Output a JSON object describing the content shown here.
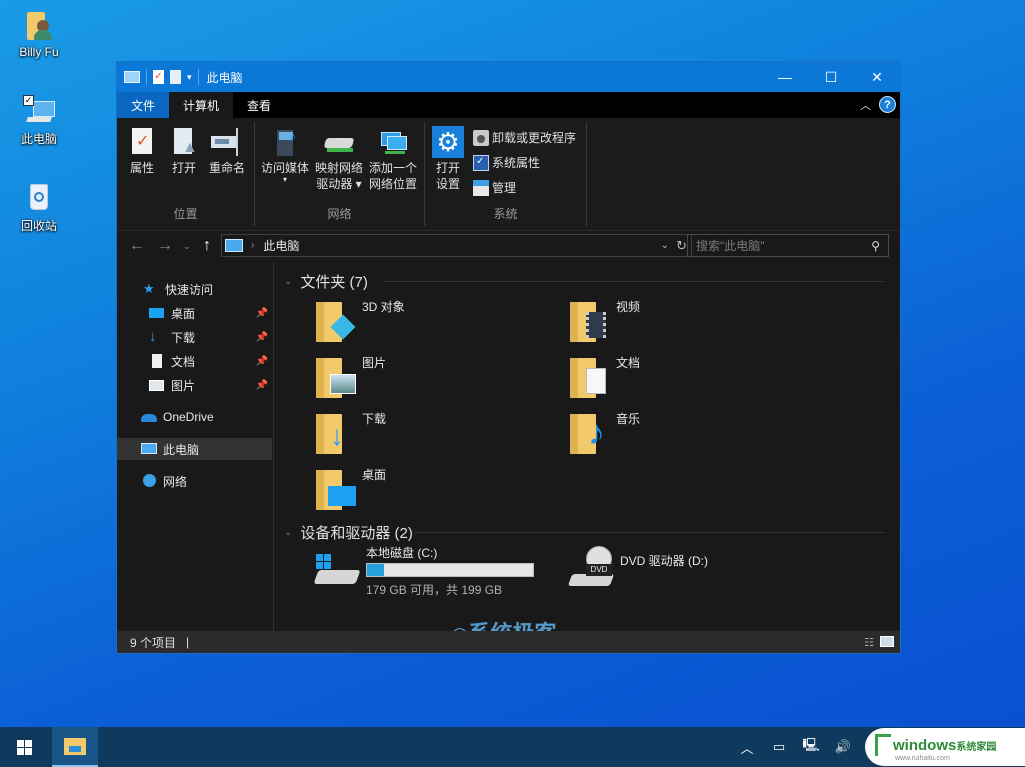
{
  "desktop": {
    "icons": [
      {
        "label": "Billy Fu",
        "icon": "user-folder-icon"
      },
      {
        "label": "此电脑",
        "icon": "this-pc-icon"
      },
      {
        "label": "回收站",
        "icon": "recycle-bin-icon"
      }
    ]
  },
  "window": {
    "title": "此电脑",
    "controls": {
      "minimize": "—",
      "maximize": "☐",
      "close": "✕"
    },
    "ribbon_tabs": [
      {
        "label": "文件"
      },
      {
        "label": "计算机"
      },
      {
        "label": "查看"
      }
    ],
    "ribbon": {
      "groups": [
        {
          "name": "位置",
          "buttons": [
            {
              "label": "属性",
              "icon": "properties-icon"
            },
            {
              "label": "打开",
              "icon": "open-icon"
            },
            {
              "label": "重命名",
              "icon": "rename-icon"
            }
          ]
        },
        {
          "name": "网络",
          "buttons": [
            {
              "label": "访问媒体",
              "icon": "media-icon",
              "dropdown": "▾"
            },
            {
              "label_line1": "映射网络",
              "label_line2": "驱动器 ▾",
              "icon": "map-drive-icon"
            },
            {
              "label_line1": "添加一个",
              "label_line2": "网络位置",
              "icon": "network-location-icon"
            }
          ]
        },
        {
          "name": "系统",
          "buttons": [
            {
              "label_line1": "打开",
              "label_line2": "设置",
              "icon": "settings-icon"
            }
          ],
          "small_buttons": [
            {
              "label": "卸载或更改程序",
              "icon": "uninstall-icon"
            },
            {
              "label": "系统属性",
              "icon": "system-properties-icon"
            },
            {
              "label": "管理",
              "icon": "manage-icon"
            }
          ]
        }
      ]
    },
    "address": {
      "path": "此电脑",
      "search_placeholder": "搜索\"此电脑\""
    },
    "nav_pane": {
      "quick_access": "快速访问",
      "items": [
        {
          "label": "桌面",
          "pinned": true
        },
        {
          "label": "下载",
          "pinned": true
        },
        {
          "label": "文档",
          "pinned": true
        },
        {
          "label": "图片",
          "pinned": true
        }
      ],
      "onedrive": "OneDrive",
      "this_pc": "此电脑",
      "network": "网络"
    },
    "content": {
      "folders_header": "文件夹 (7)",
      "folders": [
        {
          "name": "3D 对象",
          "overlay": "3d-objects-icon"
        },
        {
          "name": "视频",
          "overlay": "video-icon"
        },
        {
          "name": "图片",
          "overlay": "pictures-icon"
        },
        {
          "name": "文档",
          "overlay": "documents-icon"
        },
        {
          "name": "下载",
          "overlay": "download-icon"
        },
        {
          "name": "音乐",
          "overlay": "music-icon"
        },
        {
          "name": "桌面",
          "overlay": "desktop-icon"
        }
      ],
      "drives_header": "设备和驱动器 (2)",
      "drives": [
        {
          "name": "本地磁盘 (C:)",
          "free_text": "179 GB 可用，共 199 GB",
          "used_fraction": 0.1
        },
        {
          "name": "DVD 驱动器 (D:)",
          "badge": "DVD"
        }
      ]
    },
    "status": {
      "items": "9 个项目",
      "sep": "|"
    },
    "watermark": "系统极客"
  },
  "taskbar": {
    "brand_main": "windows",
    "brand_cn": "系统家园",
    "brand_url": "www.ruihaitu.com"
  },
  "colors": {
    "accent": "#0b78d7",
    "folder": "#f2c96b",
    "drive_bar": "#26a0da"
  }
}
